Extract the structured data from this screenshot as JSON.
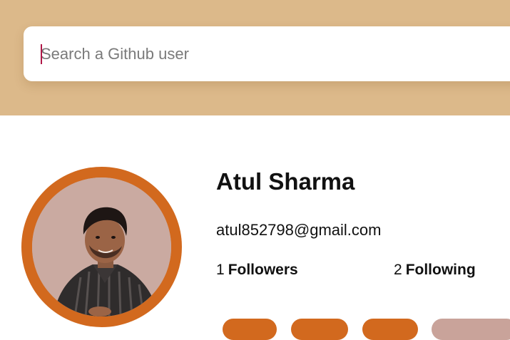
{
  "search": {
    "placeholder": "Search a Github user",
    "value": ""
  },
  "profile": {
    "name": "Atul Sharma",
    "email": "atul852798@gmail.com",
    "followers_count": "1",
    "followers_label": "Followers",
    "following_count": "2",
    "following_label": "Following"
  },
  "colors": {
    "header_bg": "#dcb98a",
    "avatar_ring": "#d2691e",
    "caret": "#b01848",
    "pill_primary": "#d2691e",
    "pill_muted": "#c9a39a"
  },
  "icons": {
    "avatar": "profile-photo"
  }
}
